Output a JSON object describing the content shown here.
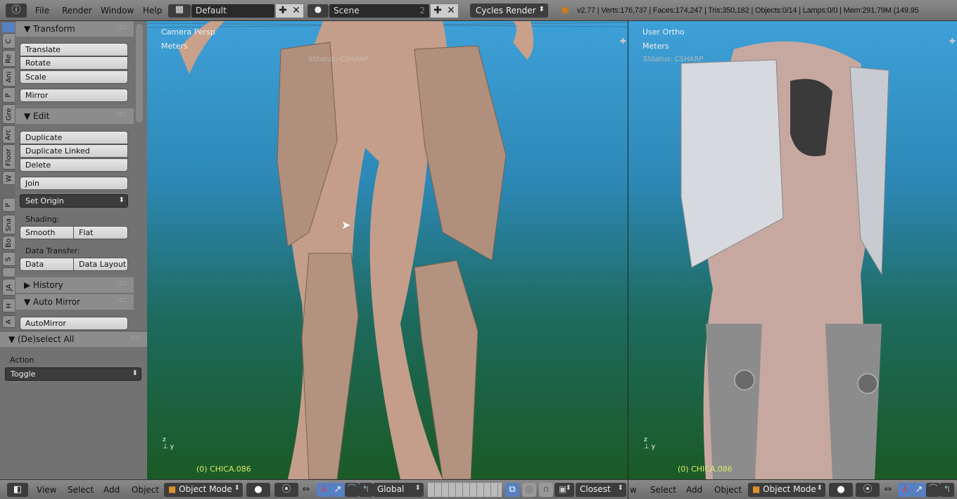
{
  "topbar": {
    "menus": [
      "File",
      "Render",
      "Window",
      "Help"
    ],
    "screen_layout": "Default",
    "scene": "Scene",
    "scene_users": "2",
    "render_engine": "Cycles Render",
    "stats": "v2.77 | Verts:176,737 | Faces:174,247 | Tris:350,182 | Objects:0/14 | Lamps:0/0 | Mem:291.79M (149.95"
  },
  "tool_tabs": [
    "C",
    "Re",
    "Ani",
    "P",
    "Gre",
    "Arc",
    "Floor",
    "W",
    "P",
    "Sna",
    "Bo",
    "S",
    "",
    "JA",
    "H",
    "A"
  ],
  "toolshelf": {
    "transform": {
      "title": "Transform",
      "buttons": [
        "Translate",
        "Rotate",
        "Scale"
      ],
      "mirror": "Mirror"
    },
    "edit": {
      "title": "Edit",
      "buttons": [
        "Duplicate",
        "Duplicate Linked",
        "Delete"
      ],
      "join": "Join",
      "set_origin": "Set Origin",
      "shading_label": "Shading:",
      "smooth": "Smooth",
      "flat": "Flat",
      "data_transfer_label": "Data Transfer:",
      "data": "Data",
      "data_layout": "Data Layout"
    },
    "history": {
      "title": "History"
    },
    "auto_mirror": {
      "title": "Auto Mirror",
      "button": "AutoMirror"
    }
  },
  "operator_panel": {
    "title": "(De)select All",
    "action_label": "Action",
    "action_value": "Toggle"
  },
  "viewport_left": {
    "view": "Camera Persp",
    "units": "Meters",
    "status": "SStatus: CSHARP",
    "object": "(0) CHICA.086"
  },
  "viewport_right": {
    "view": "User Ortho",
    "units": "Meters",
    "status": "SStatus: CSHARP",
    "object": "(0) CHICA.086"
  },
  "bottombar_left": {
    "menus": [
      "View",
      "Select",
      "Add",
      "Object"
    ],
    "mode": "Object Mode",
    "orientation": "Global",
    "snap_target": "Closest"
  },
  "bottombar_right": {
    "menus": [
      "w",
      "Select",
      "Add",
      "Object"
    ],
    "mode": "Object Mode"
  },
  "colors": {
    "object_name": "#d8e86a",
    "viewport_top": "#3ea0d8",
    "viewport_bottom": "#1b5a25",
    "active_tab": "#5680c2"
  }
}
